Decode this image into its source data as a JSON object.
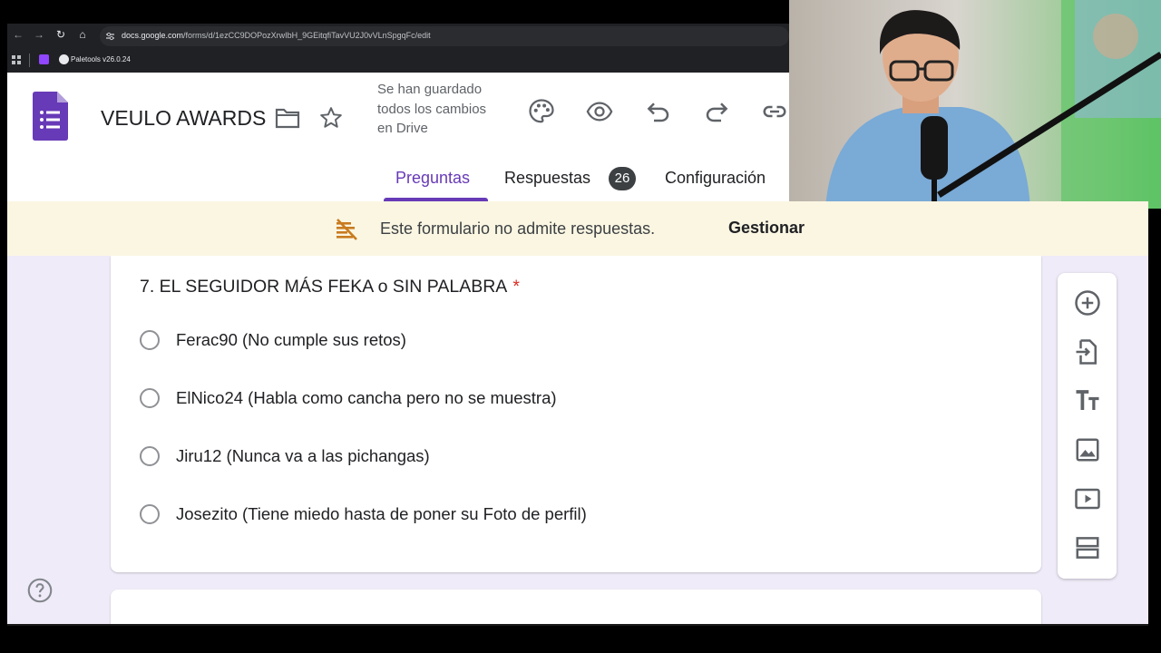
{
  "browser": {
    "url_domain": "docs.google.com",
    "url_path": "/forms/d/1ezCC9DOPozXrwIbH_9GEitqfiTavVU2J0vVLnSpgqFc/edit",
    "bookmark_label": "Paletools v26.0.24"
  },
  "header": {
    "form_title": "VEULO AWARDS",
    "save_status": "Se han guardado todos los cambios en Drive",
    "icons": [
      "folder-icon",
      "star-icon",
      "palette-icon",
      "eye-icon",
      "undo-icon",
      "redo-icon",
      "link-icon"
    ]
  },
  "tabs": {
    "preguntas": "Preguntas",
    "respuestas": "Respuestas",
    "respuestas_count": "26",
    "configuracion": "Configuración"
  },
  "banner": {
    "message": "Este formulario no admite respuestas.",
    "action": "Gestionar"
  },
  "question": {
    "title": "7. EL SEGUIDOR MÁS FEKA o SIN PALABRA",
    "required_mark": "*",
    "options": [
      "Ferac90 (No cumple sus retos)",
      "ElNico24 (Habla como cancha pero no se muestra)",
      "Jiru12 (Nunca va a las pichangas)",
      "Josezito (Tiene miedo hasta de poner su Foto de perfil)"
    ]
  },
  "toolbar": [
    "add-question-icon",
    "import-questions-icon",
    "add-title-icon",
    "add-image-icon",
    "add-video-icon",
    "add-section-icon"
  ],
  "colors": {
    "accent": "#673ab7",
    "banner": "#fbf6e2",
    "background": "#f0ebf8",
    "required": "#d93025"
  }
}
